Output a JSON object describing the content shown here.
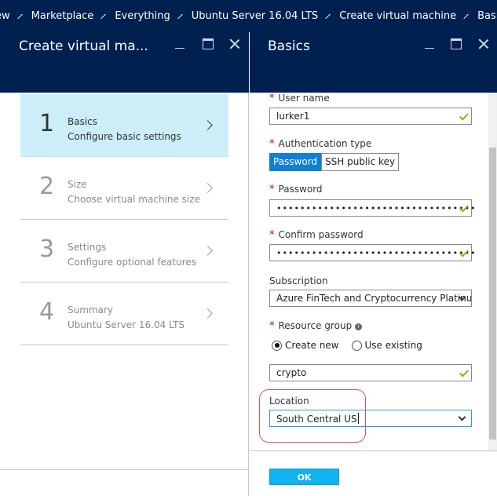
{
  "breadcrumbs": [
    "ew",
    "Marketplace",
    "Everything",
    "Ubuntu Server 16.04 LTS",
    "Create virtual machine",
    "Basics"
  ],
  "left_blade": {
    "title": "Create virtual ma...",
    "steps": [
      {
        "number": "1",
        "title": "Basics",
        "desc": "Configure basic settings"
      },
      {
        "number": "2",
        "title": "Size",
        "desc": "Choose virtual machine size"
      },
      {
        "number": "3",
        "title": "Settings",
        "desc": "Configure optional features"
      },
      {
        "number": "4",
        "title": "Summary",
        "desc": "Ubuntu Server 16.04 LTS"
      }
    ]
  },
  "right_blade": {
    "title": "Basics",
    "required_mark": "*",
    "username": {
      "label": "User name",
      "value": "lurker1"
    },
    "auth": {
      "label": "Authentication type",
      "options": [
        "Password",
        "SSH public key"
      ],
      "selected": "Password"
    },
    "password": {
      "label": "Password",
      "value": "••••••••••••••••••••••••••••••••••"
    },
    "confirm_password": {
      "label": "Confirm password",
      "value": "••••••••••••••••••••••••••••••••••"
    },
    "subscription": {
      "label": "Subscription",
      "value": "Azure FinTech and Cryptocurrency Platinum"
    },
    "resource_group": {
      "label": "Resource group",
      "info_icon": "i",
      "options": [
        "Create new",
        "Use existing"
      ],
      "selected": "Create new",
      "value": "crypto"
    },
    "location": {
      "label": "Location",
      "value": "South Central US"
    },
    "ok_label": "OK"
  },
  "colors": {
    "header_bg": "#002050",
    "active_step_bg": "#cbeef8",
    "selected_toggle": "#0f7fd4",
    "ok_button": "#0fb4ef",
    "valid_check": "#7fba00",
    "required": "#cc0000",
    "highlight_ring": "#d9534f"
  }
}
